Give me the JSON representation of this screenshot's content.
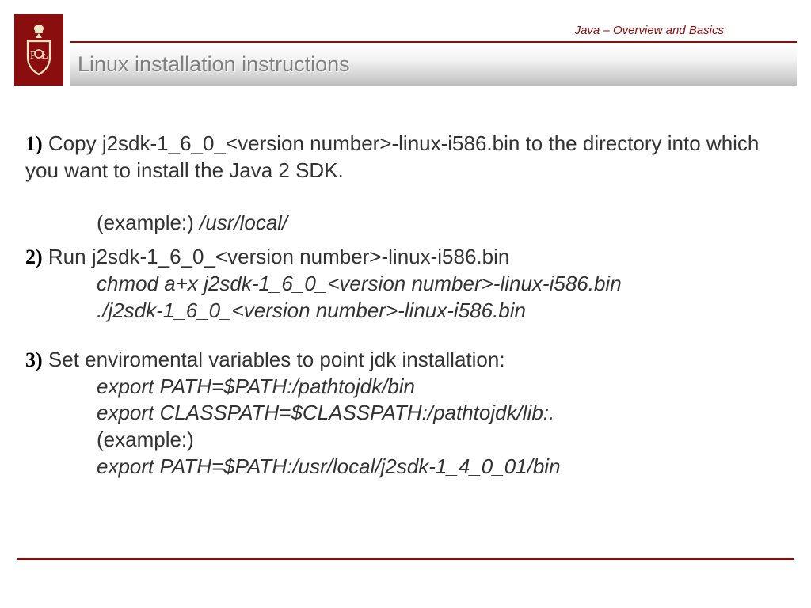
{
  "header": {
    "breadcrumb": "Java – Overview and Basics",
    "title": "Linux installation instructions"
  },
  "steps": {
    "s1": {
      "num": "1)",
      "text": "  Copy j2sdk-1_6_0_<version number>-linux-i586.bin to the directory into which you want to install the Java 2 SDK.",
      "example_label": "(example:) ",
      "example_path": "/usr/local/"
    },
    "s2": {
      "num": "2)",
      "text": "  Run j2sdk-1_6_0_<version number>-linux-i586.bin",
      "cmd1": "chmod a+x j2sdk-1_6_0_<version number>-linux-i586.bin",
      "cmd2": "./j2sdk-1_6_0_<version number>-linux-i586.bin"
    },
    "s3": {
      "num": "3)",
      "text": " Set enviromental variables to point jdk installation:",
      "cmd1": "export PATH=$PATH:/pathtojdk/bin",
      "cmd2": "export CLASSPATH=$CLASSPATH:/pathtojdk/lib:.",
      "example_label": "(example:)",
      "cmd3": "export PATH=$PATH:/usr/local/j2sdk-1_4_0_01/bin"
    }
  }
}
